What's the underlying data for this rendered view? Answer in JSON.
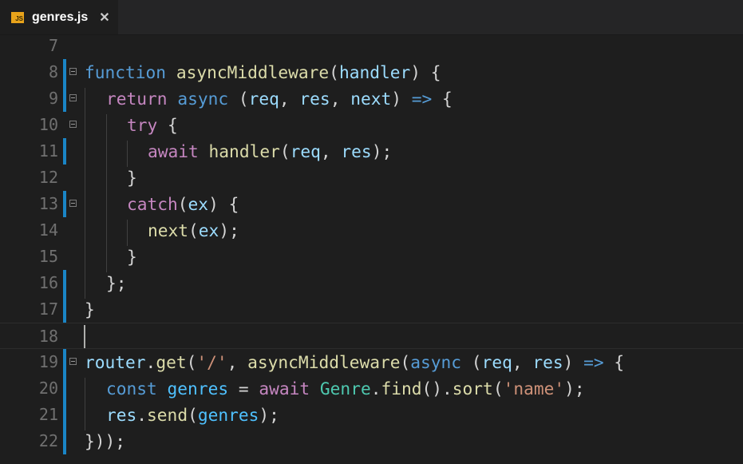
{
  "tab": {
    "file_name": "genres.js",
    "icon_label": "JS",
    "close_glyph": "✕"
  },
  "editor": {
    "lines": [
      {
        "number": "7"
      },
      {
        "number": "8"
      },
      {
        "number": "9"
      },
      {
        "number": "10"
      },
      {
        "number": "11"
      },
      {
        "number": "12"
      },
      {
        "number": "13"
      },
      {
        "number": "14"
      },
      {
        "number": "15"
      },
      {
        "number": "16"
      },
      {
        "number": "17"
      },
      {
        "number": "18"
      },
      {
        "number": "19"
      },
      {
        "number": "20"
      },
      {
        "number": "21"
      },
      {
        "number": "22"
      }
    ],
    "code": {
      "l8": [
        "function",
        " ",
        "asyncMiddleware",
        "(",
        "handler",
        ") {"
      ],
      "l9": [
        "return",
        " ",
        "async",
        " (",
        "req",
        ", ",
        "res",
        ", ",
        "next",
        ") ",
        "=>",
        " {"
      ],
      "l10": [
        "try",
        " {"
      ],
      "l11": [
        "await",
        " ",
        "handler",
        "(",
        "req",
        ", ",
        "res",
        ");"
      ],
      "l12": [
        "}"
      ],
      "l13": [
        "catch",
        "(",
        "ex",
        ") {"
      ],
      "l14": [
        "next",
        "(",
        "ex",
        ");"
      ],
      "l15": [
        "}"
      ],
      "l16": [
        "};"
      ],
      "l17": [
        "}"
      ],
      "l19": [
        "router",
        ".",
        "get",
        "(",
        "'/'",
        ", ",
        "asyncMiddleware",
        "(",
        "async",
        " (",
        "req",
        ", ",
        "res",
        ") ",
        "=>",
        " {"
      ],
      "l20": [
        "const",
        " ",
        "genres",
        " = ",
        "await",
        " ",
        "Genre",
        ".",
        "find",
        "().",
        "sort",
        "(",
        "'name'",
        ");"
      ],
      "l21": [
        "res",
        ".",
        "send",
        "(",
        "genres",
        ");"
      ],
      "l22": [
        "}));"
      ]
    }
  },
  "colors": {
    "background": "#1e1e1e",
    "keyword": "#c586c0",
    "storage": "#569cd6",
    "function": "#dcdcaa",
    "parameter": "#9cdcfe",
    "string": "#ce9178",
    "git_modified": "#1a85c6"
  }
}
